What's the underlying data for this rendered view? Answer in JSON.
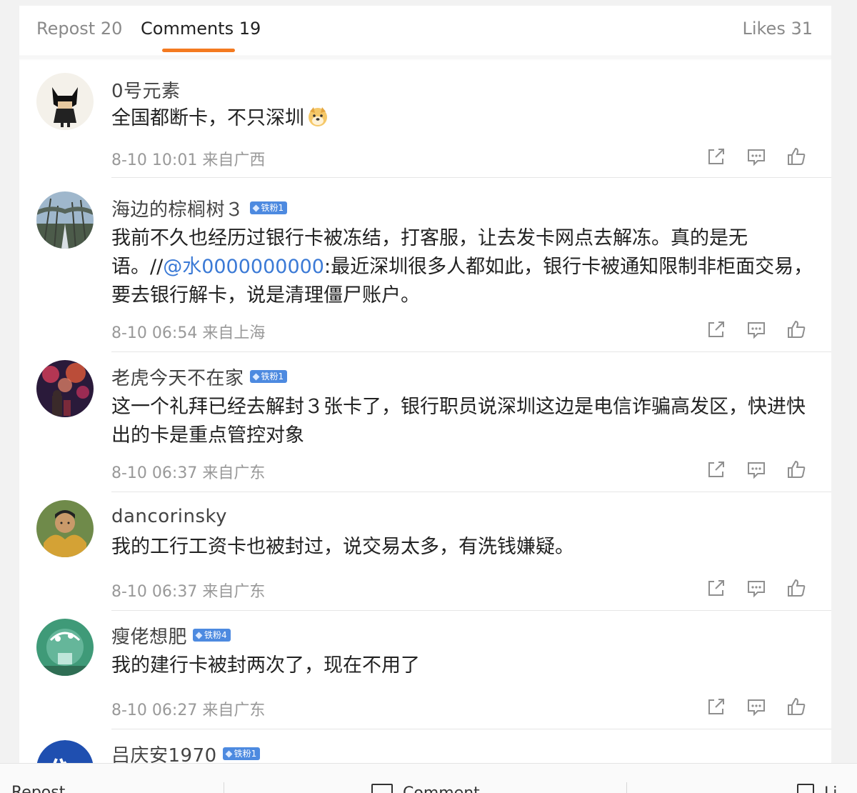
{
  "tabs": {
    "repost": "Repost 20",
    "comments": "Comments 19",
    "likes": "Likes 31"
  },
  "comments": [
    {
      "name": "0号元素",
      "badge": "",
      "text": "全国都断卡，不只深圳",
      "emoji_icon": "doge-emoji-icon",
      "meta": "8-10 10:01 来自广西"
    },
    {
      "name": "海边的棕榈树３",
      "badge": "铁粉1",
      "text_before": "我前不久也经历过银行卡被冻结，打客服，让去发卡网点去解冻。真的是无语。//",
      "mention": "@水0000000000",
      "text_after": ":最近深圳很多人都如此，银行卡被通知限制非柜面交易，要去银行解卡，说是清理僵尸账户。",
      "meta": "8-10 06:54 来自上海"
    },
    {
      "name": "老虎今天不在家",
      "badge": "铁粉1",
      "text": "这一个礼拜已经去解封３张卡了，银行职员说深圳这边是电信诈骗高发区，快进快出的卡是重点管控对象",
      "meta": "8-10 06:37 来自广东"
    },
    {
      "name": "dancorinsky",
      "badge": "",
      "text": "我的工行工资卡也被封过，说交易太多，有洗钱嫌疑。",
      "meta": "8-10 06:37 来自广东"
    },
    {
      "name": "瘦佬想肥",
      "badge": "铁粉4",
      "text": "我的建行卡被封两次了，现在不用了",
      "meta": "8-10 06:27 来自广东"
    },
    {
      "name": "吕庆安1970",
      "badge": "铁粉1"
    }
  ],
  "actions": {
    "repost_icon": "repost-icon",
    "comment_icon": "comment-icon",
    "like_icon": "like-icon"
  },
  "bottom_bar": {
    "repost": "Repost",
    "comment": "Comment",
    "like": "Li"
  },
  "colors": {
    "accent_underline": "#f47a20",
    "mention": "#3b7ad6",
    "badge": "#4d8ae0"
  }
}
